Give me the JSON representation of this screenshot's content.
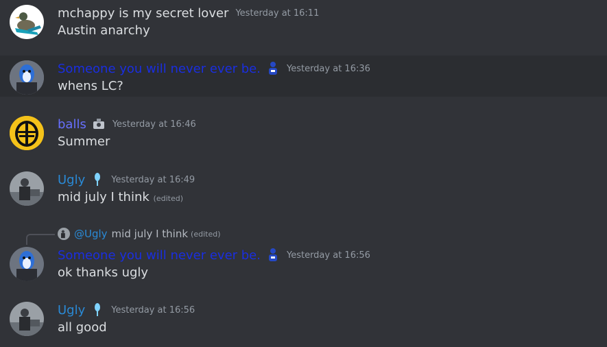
{
  "colors": {
    "background": "#313338",
    "highlight_row": "#2b2d31",
    "timestamp": "#949ba4",
    "text": "#dbdee1",
    "name_default": "#dbdee1",
    "name_blue_dark": "#1a2ee0",
    "name_blue": "#6770ff",
    "name_sky": "#2a8ad6"
  },
  "messages": [
    {
      "author": "mchappy is my secret lover",
      "timestamp": "Yesterday at 16:11",
      "text": "Austin anarchy",
      "avatar_icon": "duck-avatar-icon"
    },
    {
      "author": "Someone you will never ever be.",
      "timestamp": "Yesterday at 16:36",
      "text": "whens LC?",
      "avatar_icon": "blue-penguin-avatar-icon",
      "badge_icon": "blue-figure-badge-icon"
    },
    {
      "author": "balls",
      "timestamp": "Yesterday at 16:46",
      "text": "Summer",
      "avatar_icon": "yellow-helmet-avatar-icon",
      "badge_icon": "camera-badge-icon"
    },
    {
      "author": "Ugly",
      "timestamp": "Yesterday at 16:49",
      "text": "mid july I think",
      "edited": "(edited)",
      "avatar_icon": "photo-avatar-icon",
      "badge_icon": "blue-pin-badge-icon"
    },
    {
      "reply": {
        "mention": "@Ugly",
        "preview": "mid july I think",
        "edited": "(edited)"
      },
      "author": "Someone you will never ever be.",
      "timestamp": "Yesterday at 16:56",
      "text": "ok thanks ugly",
      "avatar_icon": "blue-penguin-avatar-icon",
      "badge_icon": "blue-figure-badge-icon"
    },
    {
      "author": "Ugly",
      "timestamp": "Yesterday at 16:56",
      "text": "all good",
      "avatar_icon": "photo-avatar-icon",
      "badge_icon": "blue-pin-badge-icon"
    }
  ]
}
